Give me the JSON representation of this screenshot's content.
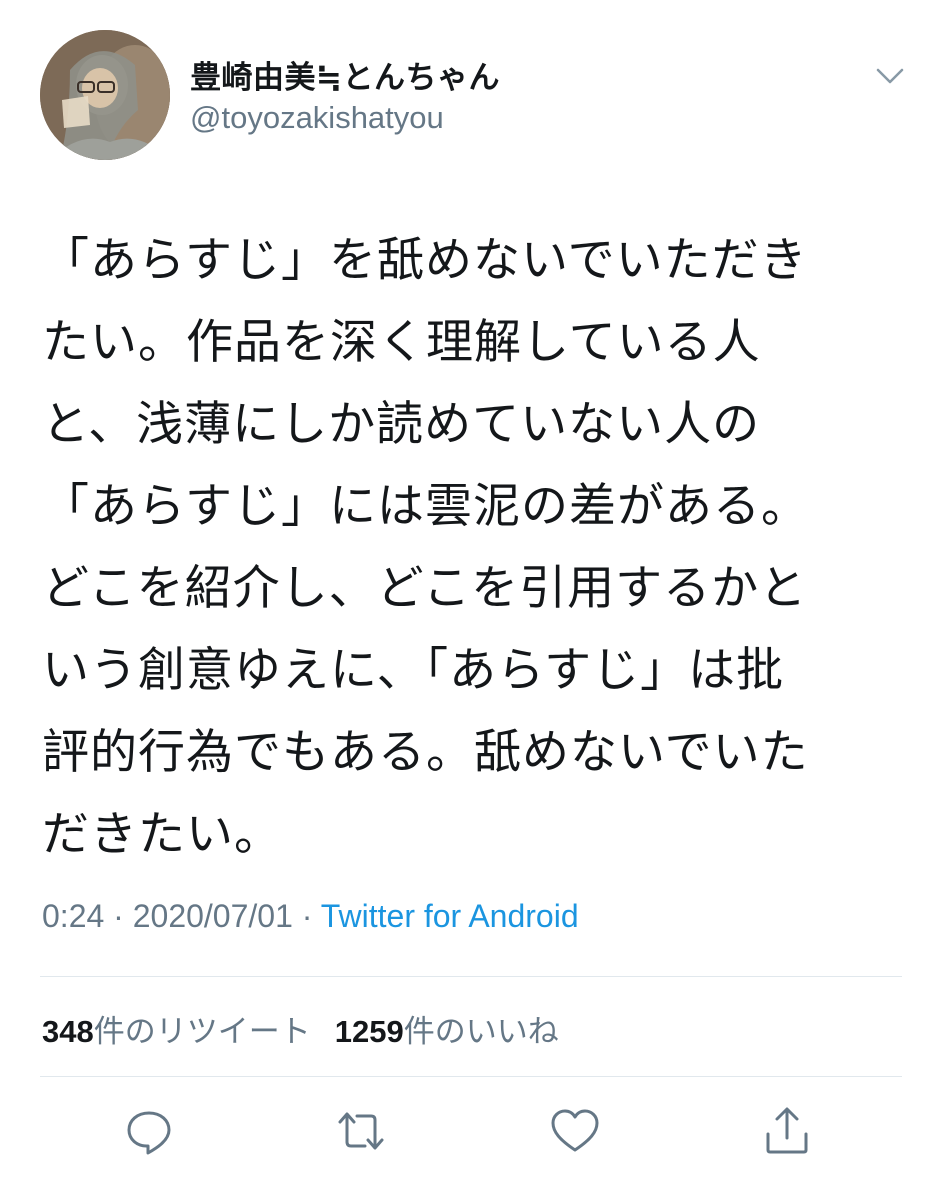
{
  "user": {
    "display_name": "豊崎由美≒とんちゃん",
    "handle": "@toyozakishatyou",
    "avatar_icon": "user-avatar-photo"
  },
  "tweet": {
    "lines": [
      "「あらすじ」を舐めないでいただき",
      "たい。作品を深く理解している人",
      "と、浅薄にしか読めていない人の",
      "「あらすじ」には雲泥の差がある。",
      "どこを紹介し、どこを引用するかと",
      "いう創意ゆえに、「あらすじ」は批",
      "評的行為でもある。舐めないでいた",
      "だきたい。"
    ]
  },
  "meta": {
    "time": "0:24",
    "date": "2020/07/01",
    "separator": "·",
    "source": "Twitter for Android"
  },
  "stats": {
    "retweet_count": "348",
    "retweet_label": "件のリツイート",
    "like_count": "1259",
    "like_label": "件のいいね"
  },
  "actions": {
    "reply_icon": "reply-icon",
    "retweet_icon": "retweet-icon",
    "like_icon": "heart-icon",
    "share_icon": "share-icon"
  },
  "colors": {
    "text": "#14171a",
    "secondary": "#657786",
    "link": "#1b95e0",
    "divider": "#e1e8ed"
  }
}
